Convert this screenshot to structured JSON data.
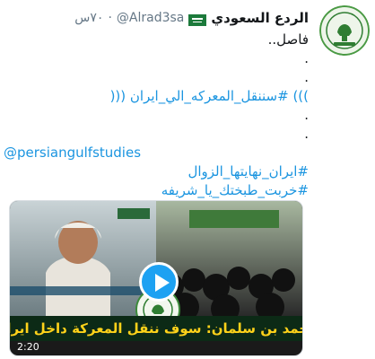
{
  "tweet": {
    "author_name": "الردع السعودي",
    "handle": "@Alrad3sa",
    "separator": "·",
    "time": "٧٠س",
    "avatar_label": "الردع السعودي",
    "lines": [
      {
        "text": "فاصل..",
        "kind": "plain"
      },
      {
        "text": ".",
        "kind": "plain"
      },
      {
        "text": ".",
        "kind": "plain"
      },
      {
        "text": "))) #سننقل_المعركه_الي_ايران (((",
        "kind": "hashtag"
      },
      {
        "text": ".",
        "kind": "plain"
      },
      {
        "text": ".",
        "kind": "plain"
      },
      {
        "text": "@persiangulfstudies",
        "kind": "mention"
      },
      {
        "text": "#ايران_نهايتها_الزوال",
        "kind": "hashtag"
      },
      {
        "text": "#خربت_طبختك_يا_شريفه",
        "kind": "hashtag"
      }
    ]
  },
  "media": {
    "caption": "محمد بن سلمان: سوف ننقل المعركة داخل ايران",
    "duration": "2:20",
    "play_label": "play",
    "logo_label": "الردع السعودي"
  },
  "icons": {
    "flag": "saudi-flag-icon",
    "play": "play-icon"
  },
  "colors": {
    "link": "#1b95e0",
    "caption_text": "#ffd21a",
    "caption_bg": "#0c2a16",
    "flag_green": "#1c7a3b"
  }
}
